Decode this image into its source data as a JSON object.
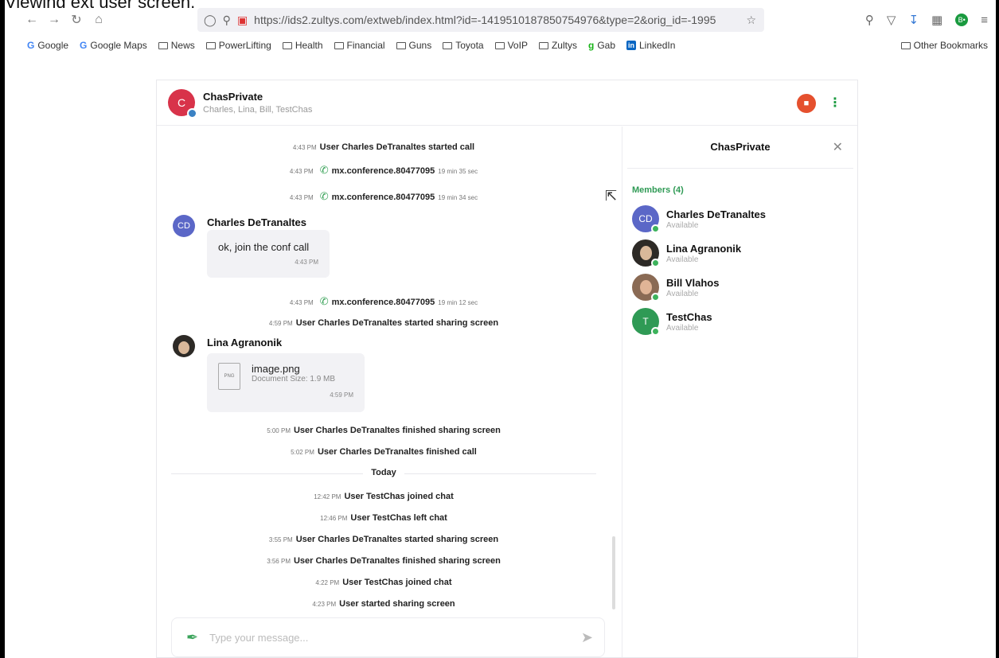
{
  "caption": "Viewing ext user screen.",
  "browser": {
    "url": "https://ids2.zultys.com/extweb/index.html?id=-1419510187850754976&type=2&orig_id=-1995",
    "bookmarks": [
      "Google",
      "Google Maps",
      "News",
      "PowerLifting",
      "Health",
      "Financial",
      "Guns",
      "Toyota",
      "VoIP",
      "Zultys",
      "Gab",
      "LinkedIn"
    ],
    "other_bookmarks": "Other Bookmarks",
    "ext_badge": "B•"
  },
  "chat": {
    "avatar_letter": "C",
    "title": "ChasPrivate",
    "participants": "Charles, Lina, Bill, TestChas"
  },
  "messages": {
    "m1": {
      "time": "4:43 PM",
      "text": "User Charles DeTranaltes started call"
    },
    "m2": {
      "time": "4:43 PM",
      "text": "mx.conference.80477095",
      "dur": "19 min 35 sec"
    },
    "m3": {
      "time": "4:43 PM",
      "text": "mx.conference.80477095",
      "dur": "19 min 34 sec"
    },
    "author1": {
      "initials": "CD",
      "name": "Charles DeTranaltes"
    },
    "bubble1": {
      "text": "ok, join the conf call",
      "time": "4:43 PM"
    },
    "m4": {
      "time": "4:43 PM",
      "text": "mx.conference.80477095",
      "dur": "19 min 12 sec"
    },
    "m5": {
      "time": "4:59 PM",
      "text": "User Charles DeTranaltes started sharing screen"
    },
    "author2": {
      "name": "Lina Agranonik"
    },
    "file": {
      "ext": "PNG",
      "name": "image.png",
      "size": "Document Size: 1.9 MB",
      "time": "4:59 PM"
    },
    "m6": {
      "time": "5:00 PM",
      "text": "User Charles DeTranaltes finished sharing screen"
    },
    "m7": {
      "time": "5:02 PM",
      "text": "User Charles DeTranaltes finished call"
    },
    "today": "Today",
    "m8": {
      "time": "12:42 PM",
      "text": "User TestChas joined chat"
    },
    "m9": {
      "time": "12:46 PM",
      "text": "User TestChas left chat"
    },
    "m10": {
      "time": "3:55 PM",
      "text": "User Charles DeTranaltes started sharing screen"
    },
    "m11": {
      "time": "3:56 PM",
      "text": "User Charles DeTranaltes finished sharing screen"
    },
    "m12": {
      "time": "4:22 PM",
      "text": "User TestChas joined chat"
    },
    "m13": {
      "time": "4:23 PM",
      "text": "User started sharing screen"
    }
  },
  "composer": {
    "placeholder": "Type your message..."
  },
  "panel": {
    "title": "ChasPrivate",
    "members_header": "Members (4)",
    "members": [
      {
        "initials": "CD",
        "name": "Charles DeTranaltes",
        "status": "Available"
      },
      {
        "initials": "",
        "name": "Lina Agranonik",
        "status": "Available"
      },
      {
        "initials": "",
        "name": "Bill Vlahos",
        "status": "Available"
      },
      {
        "initials": "T",
        "name": "TestChas",
        "status": "Available"
      }
    ]
  },
  "colors": {
    "accent": "#2f9a55",
    "hdr_avatar": "#d8334a",
    "cd_avatar": "#5b67c7",
    "call_red": "#e5502e"
  }
}
